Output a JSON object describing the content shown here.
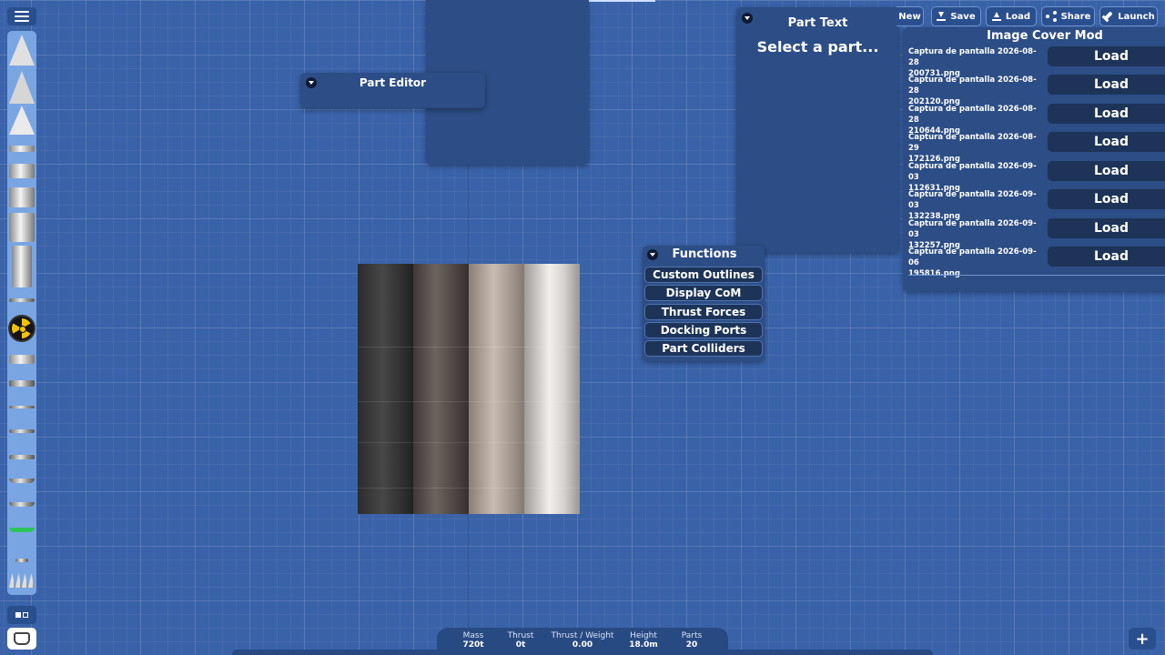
{
  "toolbar": {
    "new_label": "New",
    "save_label": "Save",
    "load_label": "Load",
    "share_label": "Share",
    "launch_label": "Launch"
  },
  "part_editor": {
    "title": "Part Editor"
  },
  "part_text": {
    "title": "Part Text",
    "subtitle": "Select a part..."
  },
  "image_cover_mod": {
    "title": "Image Cover Mod",
    "load_label": "Load",
    "files": [
      {
        "line1": "Captura de pantalla 2026-08-28",
        "line2": "200731.png"
      },
      {
        "line1": "Captura de pantalla 2026-08-28",
        "line2": "202120.png"
      },
      {
        "line1": "Captura de pantalla 2026-08-28",
        "line2": "210644.png"
      },
      {
        "line1": "Captura de pantalla 2026-08-29",
        "line2": "172126.png"
      },
      {
        "line1": "Captura de pantalla 2026-09-03",
        "line2": "112631.png"
      },
      {
        "line1": "Captura de pantalla 2026-09-03",
        "line2": "132238.png"
      },
      {
        "line1": "Captura de pantalla 2026-09-03",
        "line2": "132257.png"
      },
      {
        "line1": "Captura de pantalla 2026-09-06",
        "line2": "195816.png"
      }
    ]
  },
  "functions": {
    "title": "Functions",
    "buttons": [
      "Custom Outlines",
      "Display CoM",
      "Thrust Forces",
      "Docking Ports",
      "Part Colliders"
    ]
  },
  "stats": {
    "mass": {
      "label": "Mass",
      "value": "720t"
    },
    "thrust": {
      "label": "Thrust",
      "value": "0t"
    },
    "twr": {
      "label": "Thrust / Weight",
      "value": "0.00"
    },
    "height": {
      "label": "Height",
      "value": "18.0m"
    },
    "parts": {
      "label": "Parts",
      "value": "20"
    }
  },
  "plus_label": "+",
  "icons": {
    "menu": "hamburger-icon",
    "save": "download-icon",
    "load": "upload-icon",
    "share": "share-icon",
    "launch": "rocket-icon",
    "collapse": "collapse-triangle-icon",
    "symmetry": "symmetry-icon",
    "parts_kit": "parts-kit-icon"
  },
  "colors": {
    "background": "#3a62a8",
    "panel": "#2c4d85",
    "button_dark": "#1d3458",
    "palette": "#7aa5e3"
  }
}
